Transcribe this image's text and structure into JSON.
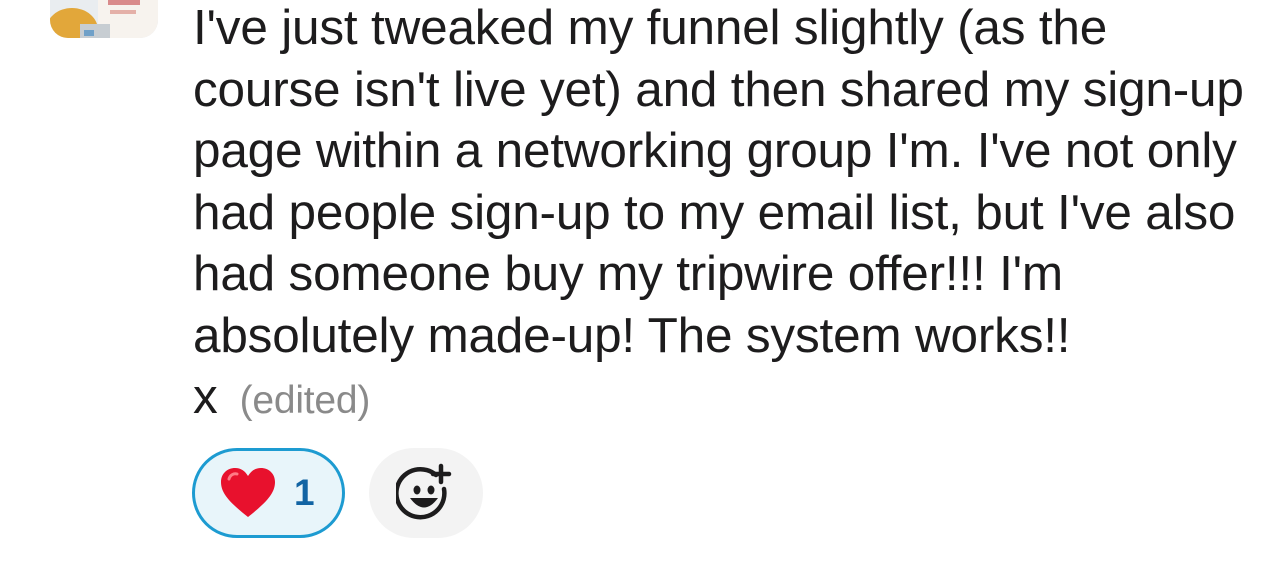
{
  "message": {
    "text": "I've just tweaked my funnel slightly (as the course isn't live yet) and then shared my sign-up page within a networking group I'm. I've not only had people sign-up to my email list, but I've also had someone buy my tripwire offer!!! I'm absolutely made-up! The system works!! x",
    "edited_label": "(edited)"
  },
  "reactions": [
    {
      "emoji": "heart-icon",
      "count": "1",
      "selected": true
    }
  ],
  "colors": {
    "reaction_border": "#1d9bd1",
    "reaction_bg": "#e8f5fa",
    "reaction_count": "#1264a3",
    "heart": "#e8112d",
    "text": "#1d1c1d",
    "edited": "#8a8a8a"
  },
  "add_reaction_icon": "add-emoji-icon"
}
